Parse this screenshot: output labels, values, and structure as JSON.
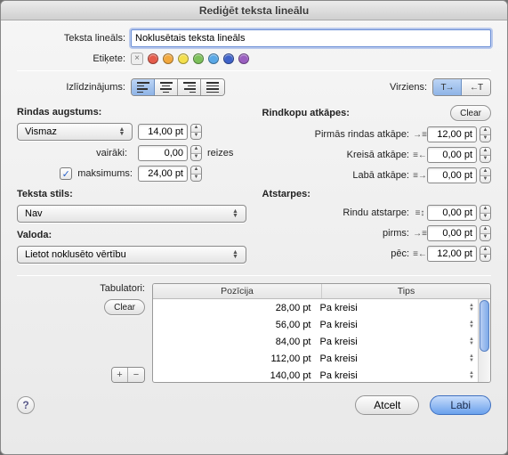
{
  "title": "Rediģēt teksta lineālu",
  "labels": {
    "name": "Teksta lineāls:",
    "etiquette": "Etiķete:",
    "align": "Izlīdzinājums:",
    "direction": "Virziens:",
    "tabs": "Tabulatori:",
    "times": "reizes"
  },
  "name_value": "Noklusētais teksta lineāls",
  "tag_colors": [
    "#e45b4a",
    "#f2a83d",
    "#f3df4b",
    "#7cc05a",
    "#59a8e6",
    "#3f63c9",
    "#9a5fc0"
  ],
  "left": {
    "section": "Rindas augstums:",
    "mode": "Vismaz",
    "line_height": "14,00 pt",
    "multiple_label": "vairāki:",
    "multiple_value": "0,00",
    "max_label": "maksimums:",
    "max_value": "24,00 pt",
    "style_label": "Teksta stils:",
    "style_value": "Nav",
    "lang_label": "Valoda:",
    "lang_value": "Lietot noklusēto vērtību"
  },
  "right": {
    "section": "Rindkopu atkāpes:",
    "clear": "Clear",
    "first": "Pirmās rindas atkāpe:",
    "first_v": "12,00 pt",
    "leftp": "Kreisā atkāpe:",
    "leftp_v": "0,00 pt",
    "rightp": "Labā atkāpe:",
    "rightp_v": "0,00 pt",
    "spacing": "Atstarpes:",
    "linesp": "Rindu atstarpe:",
    "linesp_v": "0,00 pt",
    "before": "pirms:",
    "before_v": "0,00 pt",
    "after": "pēc:",
    "after_v": "12,00 pt"
  },
  "table": {
    "clear": "Clear",
    "h1": "Pozīcija",
    "h2": "Tips",
    "rows": [
      {
        "pos": "28,00 pt",
        "type": "Pa kreisi"
      },
      {
        "pos": "56,00 pt",
        "type": "Pa kreisi"
      },
      {
        "pos": "84,00 pt",
        "type": "Pa kreisi"
      },
      {
        "pos": "112,00 pt",
        "type": "Pa kreisi"
      },
      {
        "pos": "140,00 pt",
        "type": "Pa kreisi"
      }
    ]
  },
  "buttons": {
    "cancel": "Atcelt",
    "ok": "Labi"
  }
}
